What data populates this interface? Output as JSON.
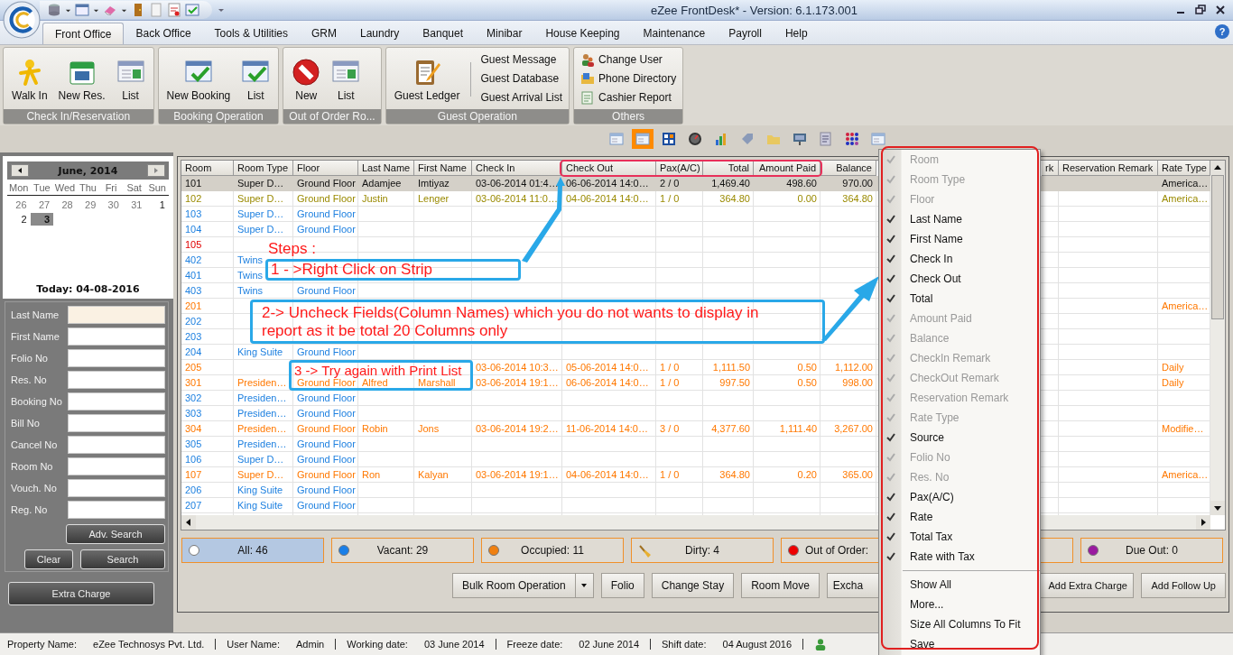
{
  "window": {
    "title": "eZee FrontDesk* - Version: 6.1.173.001"
  },
  "tabs": [
    {
      "label": "Front Office",
      "selected": true
    },
    {
      "label": "Back Office",
      "selected": false
    },
    {
      "label": "Tools & Utilities",
      "selected": false
    },
    {
      "label": "GRM",
      "selected": false
    },
    {
      "label": "Laundry",
      "selected": false
    },
    {
      "label": "Banquet",
      "selected": false
    },
    {
      "label": "Minibar",
      "selected": false
    },
    {
      "label": "House Keeping",
      "selected": false
    },
    {
      "label": "Maintenance",
      "selected": false
    },
    {
      "label": "Payroll",
      "selected": false
    },
    {
      "label": "Help",
      "selected": false
    }
  ],
  "help_button": "?",
  "ribbon": [
    {
      "title": "Check In/Reservation",
      "buttons": [
        "Walk In",
        "New Res.",
        "List"
      ]
    },
    {
      "title": "Booking Operation",
      "buttons": [
        "New Booking",
        "List"
      ]
    },
    {
      "title": "Out of Order Ro...",
      "buttons": [
        "New",
        "List"
      ]
    },
    {
      "title": "Guest Operation",
      "buttons": [
        "Guest Ledger"
      ],
      "links": [
        "Guest Message",
        "Guest Database",
        "Guest Arrival List"
      ]
    },
    {
      "title": "Others",
      "links": [
        "Change User",
        "Phone Directory",
        "Cashier Report"
      ]
    }
  ],
  "toolbar": [
    {
      "selected": false
    },
    {
      "selected": true
    },
    {
      "selected": false
    },
    {
      "selected": false
    },
    {
      "selected": false
    },
    {
      "selected": false
    },
    {
      "selected": false
    },
    {
      "selected": false
    },
    {
      "selected": false
    },
    {
      "selected": false
    },
    {
      "selected": false
    }
  ],
  "calendar": {
    "month": "June, 2014",
    "weekdays": [
      "Mon",
      "Tue",
      "Wed",
      "Thu",
      "Fri",
      "Sat",
      "Sun"
    ],
    "days": [
      {
        "day": "26",
        "other_month": true,
        "selected": false
      },
      {
        "day": "27",
        "other_month": true,
        "selected": false
      },
      {
        "day": "28",
        "other_month": true,
        "selected": false
      },
      {
        "day": "29",
        "other_month": true,
        "selected": false
      },
      {
        "day": "30",
        "other_month": true,
        "selected": false
      },
      {
        "day": "31",
        "other_month": true,
        "selected": false
      },
      {
        "day": "1",
        "other_month": false,
        "selected": false
      },
      {
        "day": "2",
        "other_month": false,
        "selected": false
      },
      {
        "day": "3",
        "other_month": false,
        "selected": true
      }
    ],
    "today": "Today: 04-08-2016"
  },
  "search": {
    "fields": [
      {
        "label": "Last Name",
        "focused": true
      },
      {
        "label": "First Name",
        "focused": false
      },
      {
        "label": "Folio No",
        "focused": false
      },
      {
        "label": "Res. No",
        "focused": false
      },
      {
        "label": "Booking No",
        "focused": false
      },
      {
        "label": "Bill No",
        "focused": false
      },
      {
        "label": "Cancel No",
        "focused": false
      },
      {
        "label": "Room No",
        "focused": false
      },
      {
        "label": "Vouch. No",
        "focused": false
      },
      {
        "label": "Reg. No",
        "focused": false
      }
    ],
    "adv_button": "Adv. Search",
    "clear_button": "Clear",
    "search_button": "Search"
  },
  "extra_charge_button": "Extra Charge",
  "grid": {
    "columns": [
      "Room",
      "Room Type",
      "Floor",
      "Last Name",
      "First Name",
      "Check In",
      "Check Out",
      "Pax(A/C)",
      "Total",
      "Amount Paid",
      "Balance"
    ],
    "right_columns": [
      "rk",
      "Reservation Remark",
      "Rate Type"
    ],
    "rows": [
      {
        "selected": true,
        "cells": [
          "101",
          "Super D…",
          "Ground Floor",
          "Adamjee",
          "Imtiyaz",
          "03-06-2014 01:4…",
          "06-06-2014 14:0…",
          "2 / 0",
          "1,469.40",
          "498.60",
          "970.00"
        ],
        "rate_type": "America…"
      },
      {
        "kind": "departure",
        "selected": false,
        "cells": [
          "102",
          "Super D…",
          "Ground Floor",
          "Justin",
          "Lenger",
          "03-06-2014 11:0…",
          "04-06-2014 14:0…",
          "1 / 0",
          "364.80",
          "0.00",
          "364.80"
        ],
        "rate_type": "America…"
      },
      {
        "kind": "vacant",
        "selected": false,
        "cells": [
          "103",
          "Super D…",
          "Ground Floor",
          null,
          null,
          null,
          null,
          null,
          null,
          null,
          null
        ],
        "rate_type": null
      },
      {
        "kind": "vacant",
        "selected": false,
        "cells": [
          "104",
          "Super D…",
          "Ground Floor",
          null,
          null,
          null,
          null,
          null,
          null,
          null,
          null
        ],
        "rate_type": null
      },
      {
        "kind": "out_of_order",
        "selected": false,
        "cells": [
          "105",
          null,
          null,
          null,
          null,
          null,
          null,
          null,
          null,
          null,
          null
        ],
        "rate_type": null
      },
      {
        "kind": "vacant",
        "selected": false,
        "cells": [
          "402",
          "Twins",
          null,
          null,
          null,
          null,
          null,
          null,
          null,
          null,
          null
        ],
        "rate_type": null
      },
      {
        "kind": "vacant",
        "selected": false,
        "cells": [
          "401",
          "Twins",
          null,
          null,
          null,
          null,
          null,
          null,
          null,
          null,
          null
        ],
        "rate_type": null
      },
      {
        "kind": "vacant",
        "selected": false,
        "cells": [
          "403",
          "Twins",
          "Ground Floor",
          null,
          null,
          null,
          null,
          null,
          null,
          null,
          null
        ],
        "rate_type": null
      },
      {
        "kind": "occupied",
        "selected": false,
        "cells": [
          "201",
          null,
          null,
          null,
          null,
          null,
          null,
          null,
          null,
          null,
          null
        ],
        "rate_type": "America…"
      },
      {
        "kind": "vacant",
        "selected": false,
        "cells": [
          "202",
          null,
          null,
          null,
          null,
          null,
          null,
          null,
          null,
          null,
          null
        ],
        "rate_type": null
      },
      {
        "kind": "vacant",
        "selected": false,
        "cells": [
          "203",
          null,
          null,
          null,
          null,
          null,
          null,
          null,
          null,
          null,
          null
        ],
        "rate_type": null
      },
      {
        "kind": "vacant",
        "selected": false,
        "cells": [
          "204",
          "King Suite",
          "Ground Floor",
          null,
          null,
          null,
          null,
          null,
          null,
          null,
          null
        ],
        "rate_type": null
      },
      {
        "kind": "occupied",
        "selected": false,
        "cells": [
          "205",
          null,
          null,
          null,
          null,
          "03-06-2014 10:3…",
          "05-06-2014 14:0…",
          "1 / 0",
          "1,111.50",
          "0.50",
          "1,112.00"
        ],
        "rate_type": "Daily"
      },
      {
        "kind": "occupied",
        "selected": false,
        "cells": [
          "301",
          "Presiden…",
          "Ground Floor",
          "Alfred",
          "Marshall",
          "03-06-2014 19:1…",
          "06-06-2014 14:0…",
          "1 / 0",
          "997.50",
          "0.50",
          "998.00"
        ],
        "rate_type": "Daily"
      },
      {
        "kind": "vacant",
        "selected": false,
        "cells": [
          "302",
          "Presiden…",
          "Ground Floor",
          null,
          null,
          null,
          null,
          null,
          null,
          null,
          null
        ],
        "rate_type": null
      },
      {
        "kind": "vacant",
        "selected": false,
        "cells": [
          "303",
          "Presiden…",
          "Ground Floor",
          null,
          null,
          null,
          null,
          null,
          null,
          null,
          null
        ],
        "rate_type": null
      },
      {
        "kind": "occupied",
        "selected": false,
        "cells": [
          "304",
          "Presiden…",
          "Ground Floor",
          "Robin",
          "Jons",
          "03-06-2014 19:2…",
          "11-06-2014 14:0…",
          "3 / 0",
          "4,377.60",
          "1,111.40",
          "3,267.00"
        ],
        "rate_type": "Modifie…"
      },
      {
        "kind": "vacant",
        "selected": false,
        "cells": [
          "305",
          "Presiden…",
          "Ground Floor",
          null,
          null,
          null,
          null,
          null,
          null,
          null,
          null
        ],
        "rate_type": null
      },
      {
        "kind": "vacant",
        "selected": false,
        "cells": [
          "106",
          "Super D…",
          "Ground Floor",
          null,
          null,
          null,
          null,
          null,
          null,
          null,
          null
        ],
        "rate_type": null
      },
      {
        "kind": "occupied",
        "selected": false,
        "cells": [
          "107",
          "Super D…",
          "Ground Floor",
          "Ron",
          "Kalyan",
          "03-06-2014 19:1…",
          "04-06-2014 14:0…",
          "1 / 0",
          "364.80",
          "0.20",
          "365.00"
        ],
        "rate_type": "America…"
      },
      {
        "kind": "vacant",
        "selected": false,
        "cells": [
          "206",
          "King Suite",
          "Ground Floor",
          null,
          null,
          null,
          null,
          null,
          null,
          null,
          null
        ],
        "rate_type": null
      },
      {
        "kind": "vacant",
        "selected": false,
        "cells": [
          "207",
          "King Suite",
          "Ground Floor",
          null,
          null,
          null,
          null,
          null,
          null,
          null,
          null
        ],
        "rate_type": null
      }
    ]
  },
  "filters": [
    {
      "kind": "dot",
      "label": "All: 46",
      "color": "#ffffff",
      "selected": true
    },
    {
      "kind": "dot",
      "label": "Vacant: 29",
      "color": "#1a7fe8",
      "selected": false
    },
    {
      "kind": "dot",
      "label": "Occupied: 11",
      "color": "#f08010",
      "selected": false
    },
    {
      "kind": "broom",
      "label": "Dirty: 4",
      "selected": false
    },
    {
      "kind": "clipped",
      "label": "Out of Order:",
      "color": "#ee0000",
      "selected": false
    },
    {
      "kind": "blank",
      "selected": false
    },
    {
      "kind": "dot",
      "label": "Due Out: 0",
      "color": "#9a1aa0",
      "selected": false
    }
  ],
  "actions": [
    {
      "kind": "split",
      "label": "Bulk Room Operation"
    },
    {
      "kind": "plain",
      "label": "Folio"
    },
    {
      "kind": "plain",
      "label": "Change Stay"
    },
    {
      "kind": "plain",
      "label": "Room Move"
    },
    {
      "kind": "cut",
      "label": "Excha"
    }
  ],
  "actions_right": [
    "Add Extra Charge",
    "Add Follow Up"
  ],
  "status_bar": [
    {
      "label": "Property Name:",
      "value": "eZee Technosys Pvt. Ltd."
    },
    {
      "label": "User Name:",
      "value": "Admin"
    },
    {
      "label": "Working date:",
      "value": "03 June 2014"
    },
    {
      "label": "Freeze date:",
      "value": "02 June 2014"
    },
    {
      "label": "Shift date:",
      "value": "04 August 2016"
    }
  ],
  "context_menu": {
    "columns": [
      {
        "label": "Room",
        "checked": true,
        "disabled": true
      },
      {
        "label": "Room Type",
        "checked": true,
        "disabled": true
      },
      {
        "label": "Floor",
        "checked": true,
        "disabled": true
      },
      {
        "label": "Last Name",
        "checked": true,
        "disabled": false
      },
      {
        "label": "First Name",
        "checked": true,
        "disabled": false
      },
      {
        "label": "Check In",
        "checked": true,
        "disabled": false
      },
      {
        "label": "Check Out",
        "checked": true,
        "disabled": false
      },
      {
        "label": "Total",
        "checked": true,
        "disabled": false
      },
      {
        "label": "Amount Paid",
        "checked": true,
        "disabled": true
      },
      {
        "label": "Balance",
        "checked": true,
        "disabled": true
      },
      {
        "label": "CheckIn Remark",
        "checked": true,
        "disabled": true
      },
      {
        "label": "CheckOut Remark",
        "checked": true,
        "disabled": true
      },
      {
        "label": "Reservation Remark",
        "checked": true,
        "disabled": true
      },
      {
        "label": "Rate Type",
        "checked": true,
        "disabled": true
      },
      {
        "label": "Source",
        "checked": true,
        "disabled": false
      },
      {
        "label": "Folio No",
        "checked": true,
        "disabled": true
      },
      {
        "label": "Res. No",
        "checked": true,
        "disabled": true
      },
      {
        "label": "Pax(A/C)",
        "checked": true,
        "disabled": false
      },
      {
        "label": "Rate",
        "checked": true,
        "disabled": false
      },
      {
        "label": "Total Tax",
        "checked": true,
        "disabled": false
      },
      {
        "label": "Rate with Tax",
        "checked": true,
        "disabled": false
      }
    ],
    "actions": [
      "Show All",
      "More...",
      "Size All Columns To Fit",
      "Save"
    ]
  },
  "annotations": {
    "heading": "Steps :",
    "steps": [
      "1 - >Right Click on Strip",
      "2-> Uncheck Fields(Column Names) which you do not wants to display in report as it be total 20 Columns only",
      "3 -> Try again with Print List"
    ]
  }
}
